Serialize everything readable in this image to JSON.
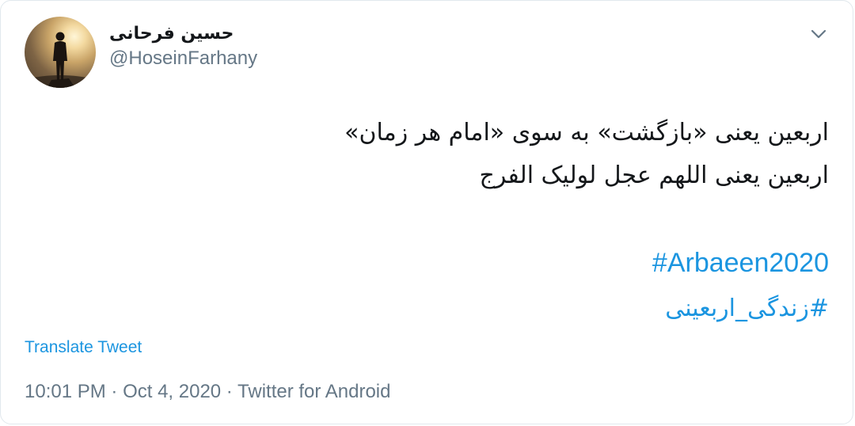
{
  "author": {
    "display_name": "حسین فرحانی",
    "handle": "@HoseinFarhany"
  },
  "tweet": {
    "lines": [
      "اربعین یعنی «بازگشت» به سوی  «امام هر زمان»",
      "اربعین یعنی اللهم عجل لولیک الفرج"
    ],
    "hashtags": [
      "#Arbaeen2020",
      "#زندگی_اربعینی"
    ]
  },
  "translate_label": "Translate Tweet",
  "meta": {
    "time": "10:01 PM",
    "separator": " · ",
    "date": "Oct 4, 2020",
    "source": "Twitter for Android"
  },
  "colors": {
    "link": "#1b95e0",
    "text": "#14171a",
    "muted": "#657786"
  },
  "icons": {
    "menu": "chevron-down-icon"
  }
}
